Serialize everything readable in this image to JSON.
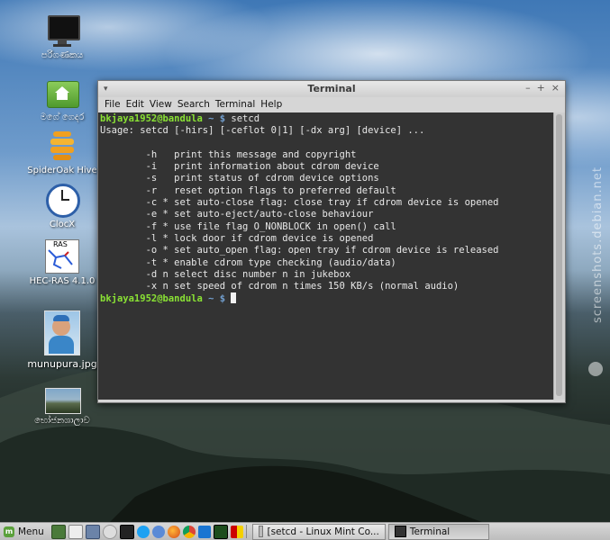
{
  "desktop": {
    "icons": [
      {
        "label": "පරිගණකය",
        "icon": "computer-icon"
      },
      {
        "label": "මගේ ගෙදර",
        "icon": "home-folder-icon"
      },
      {
        "label": "SpiderOak Hive",
        "icon": "spideroak-icon"
      },
      {
        "label": "ClocX",
        "icon": "clock-icon"
      },
      {
        "label": "HEC-RAS 4.1.0",
        "icon": "hec-ras-icon"
      },
      {
        "label": "munupura.jpg",
        "icon": "photo-icon"
      },
      {
        "label": "භෝජනශාලාව",
        "icon": "photo-icon"
      }
    ],
    "watermark": "screenshots.debian.net"
  },
  "window": {
    "title": "Terminal",
    "menu": [
      "File",
      "Edit",
      "View",
      "Search",
      "Terminal",
      "Help"
    ]
  },
  "terminal": {
    "prompt_user": "bkjaya1952@bandula",
    "prompt_path": " ~ $ ",
    "command": "setcd",
    "output": [
      "Usage: setcd [-hirs] [-ceflot 0|1] [-dx arg] [device] ...",
      "",
      "        -h   print this message and copyright",
      "        -i   print information about cdrom device",
      "        -s   print status of cdrom device options",
      "        -r   reset option flags to preferred default",
      "        -c * set auto-close flag: close tray if cdrom device is opened",
      "        -e * set auto-eject/auto-close behaviour",
      "        -f * use file flag O_NONBLOCK in open() call",
      "        -l * lock door if cdrom device is opened",
      "        -o * set auto_open flag: open tray if cdrom device is released",
      "        -t * enable cdrom type checking (audio/data)",
      "        -d n select disc number n in jukebox",
      "        -x n set speed of cdrom n times 150 KB/s (normal audio)"
    ]
  },
  "panel": {
    "menu_label": "Menu",
    "tasks": [
      {
        "label": "[setcd - Linux Mint Co..."
      },
      {
        "label": "Terminal"
      }
    ]
  },
  "colors": {
    "terminal_bg": "#333333",
    "prompt_user": "#8ae234",
    "prompt_path": "#729fcf"
  }
}
